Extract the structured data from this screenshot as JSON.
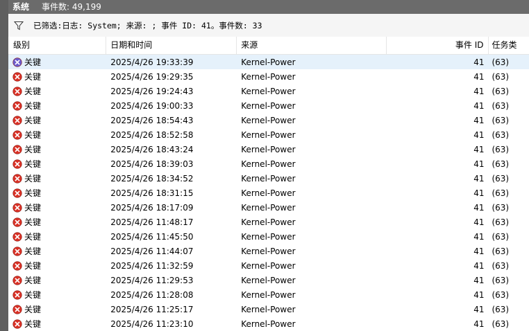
{
  "window": {
    "log_name": "系统",
    "event_count_label": "事件数: 49,199"
  },
  "filter": {
    "text": "已筛选:日志: System; 来源: ; 事件 ID: 41。事件数: 33"
  },
  "columns": {
    "level": "级别",
    "datetime": "日期和时间",
    "source": "来源",
    "event_id": "事件 ID",
    "task": "任务类"
  },
  "rows": [
    {
      "level": "关键",
      "datetime": "2025/4/26 19:33:39",
      "source": "Kernel-Power",
      "event_id": "41",
      "task": "(63)"
    },
    {
      "level": "关键",
      "datetime": "2025/4/26 19:29:35",
      "source": "Kernel-Power",
      "event_id": "41",
      "task": "(63)"
    },
    {
      "level": "关键",
      "datetime": "2025/4/26 19:24:43",
      "source": "Kernel-Power",
      "event_id": "41",
      "task": "(63)"
    },
    {
      "level": "关键",
      "datetime": "2025/4/26 19:00:33",
      "source": "Kernel-Power",
      "event_id": "41",
      "task": "(63)"
    },
    {
      "level": "关键",
      "datetime": "2025/4/26 18:54:43",
      "source": "Kernel-Power",
      "event_id": "41",
      "task": "(63)"
    },
    {
      "level": "关键",
      "datetime": "2025/4/26 18:52:58",
      "source": "Kernel-Power",
      "event_id": "41",
      "task": "(63)"
    },
    {
      "level": "关键",
      "datetime": "2025/4/26 18:43:24",
      "source": "Kernel-Power",
      "event_id": "41",
      "task": "(63)"
    },
    {
      "level": "关键",
      "datetime": "2025/4/26 18:39:03",
      "source": "Kernel-Power",
      "event_id": "41",
      "task": "(63)"
    },
    {
      "level": "关键",
      "datetime": "2025/4/26 18:34:52",
      "source": "Kernel-Power",
      "event_id": "41",
      "task": "(63)"
    },
    {
      "level": "关键",
      "datetime": "2025/4/26 18:31:15",
      "source": "Kernel-Power",
      "event_id": "41",
      "task": "(63)"
    },
    {
      "level": "关键",
      "datetime": "2025/4/26 18:17:09",
      "source": "Kernel-Power",
      "event_id": "41",
      "task": "(63)"
    },
    {
      "level": "关键",
      "datetime": "2025/4/26 11:48:17",
      "source": "Kernel-Power",
      "event_id": "41",
      "task": "(63)"
    },
    {
      "level": "关键",
      "datetime": "2025/4/26 11:45:50",
      "source": "Kernel-Power",
      "event_id": "41",
      "task": "(63)"
    },
    {
      "level": "关键",
      "datetime": "2025/4/26 11:44:07",
      "source": "Kernel-Power",
      "event_id": "41",
      "task": "(63)"
    },
    {
      "level": "关键",
      "datetime": "2025/4/26 11:32:59",
      "source": "Kernel-Power",
      "event_id": "41",
      "task": "(63)"
    },
    {
      "level": "关键",
      "datetime": "2025/4/26 11:29:53",
      "source": "Kernel-Power",
      "event_id": "41",
      "task": "(63)"
    },
    {
      "level": "关键",
      "datetime": "2025/4/26 11:28:08",
      "source": "Kernel-Power",
      "event_id": "41",
      "task": "(63)"
    },
    {
      "level": "关键",
      "datetime": "2025/4/26 11:25:17",
      "source": "Kernel-Power",
      "event_id": "41",
      "task": "(63)"
    },
    {
      "level": "关键",
      "datetime": "2025/4/26 11:23:10",
      "source": "Kernel-Power",
      "event_id": "41",
      "task": "(63)"
    }
  ],
  "icons": {
    "filter": "filter-funnel-icon",
    "critical": "critical-error-icon"
  },
  "colors": {
    "critical_red": "#d93025",
    "critical_selected": "#6a5acd",
    "selection": "#e5f1fb"
  }
}
